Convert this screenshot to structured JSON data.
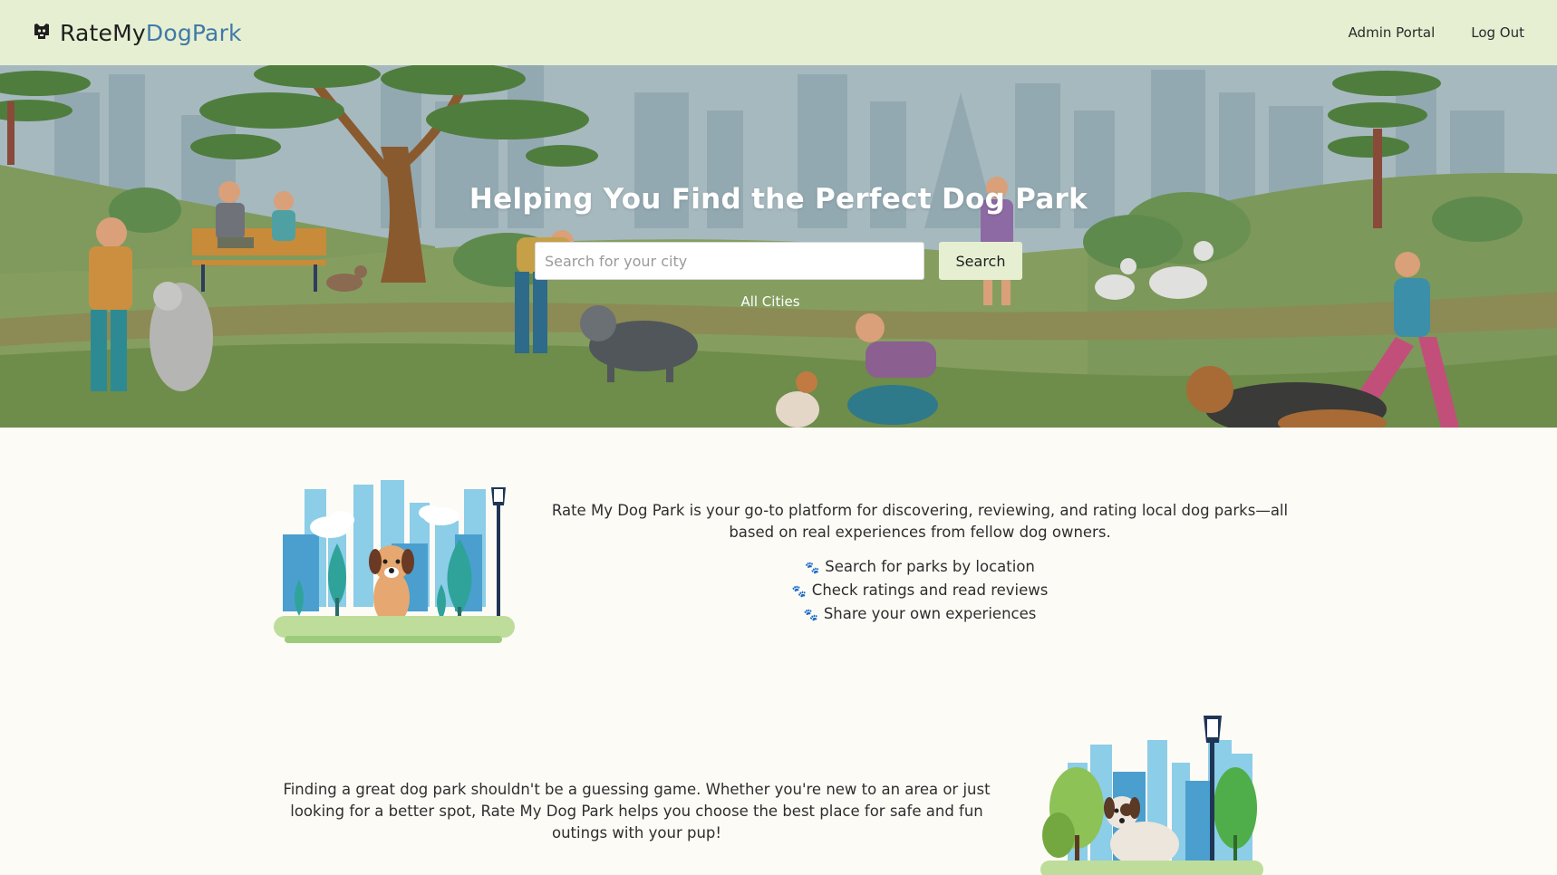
{
  "header": {
    "brand_part1": "RateMy",
    "brand_part2": "DogPark",
    "brand_icon": "dog-head-icon",
    "nav": [
      {
        "label": "Admin Portal"
      },
      {
        "label": "Log Out"
      }
    ]
  },
  "hero": {
    "title": "Helping You Find the Perfect Dog Park",
    "search_placeholder": "Search for your city",
    "search_value": "",
    "search_button": "Search",
    "all_cities_link": "All Cities"
  },
  "about": {
    "intro": "Rate My Dog Park is your go-to platform for discovering, reviewing, and rating local dog parks—all based on real experiences from fellow dog owners.",
    "features": [
      "Search for parks by location",
      "Check ratings and read reviews",
      "Share your own experiences"
    ],
    "bullet_icon": "paw-icon"
  },
  "finding": {
    "text": "Finding a great dog park shouldn't be a guessing game. Whether you're new to an area or just looking for a better spot, Rate My Dog Park helps you choose the best place for safe and fun outings with your pup!"
  },
  "colors": {
    "nav_bg": "#e6efd2",
    "brand_accent": "#3f7aa8",
    "page_bg": "#fdfbf6",
    "hero_text": "#ffffff"
  }
}
